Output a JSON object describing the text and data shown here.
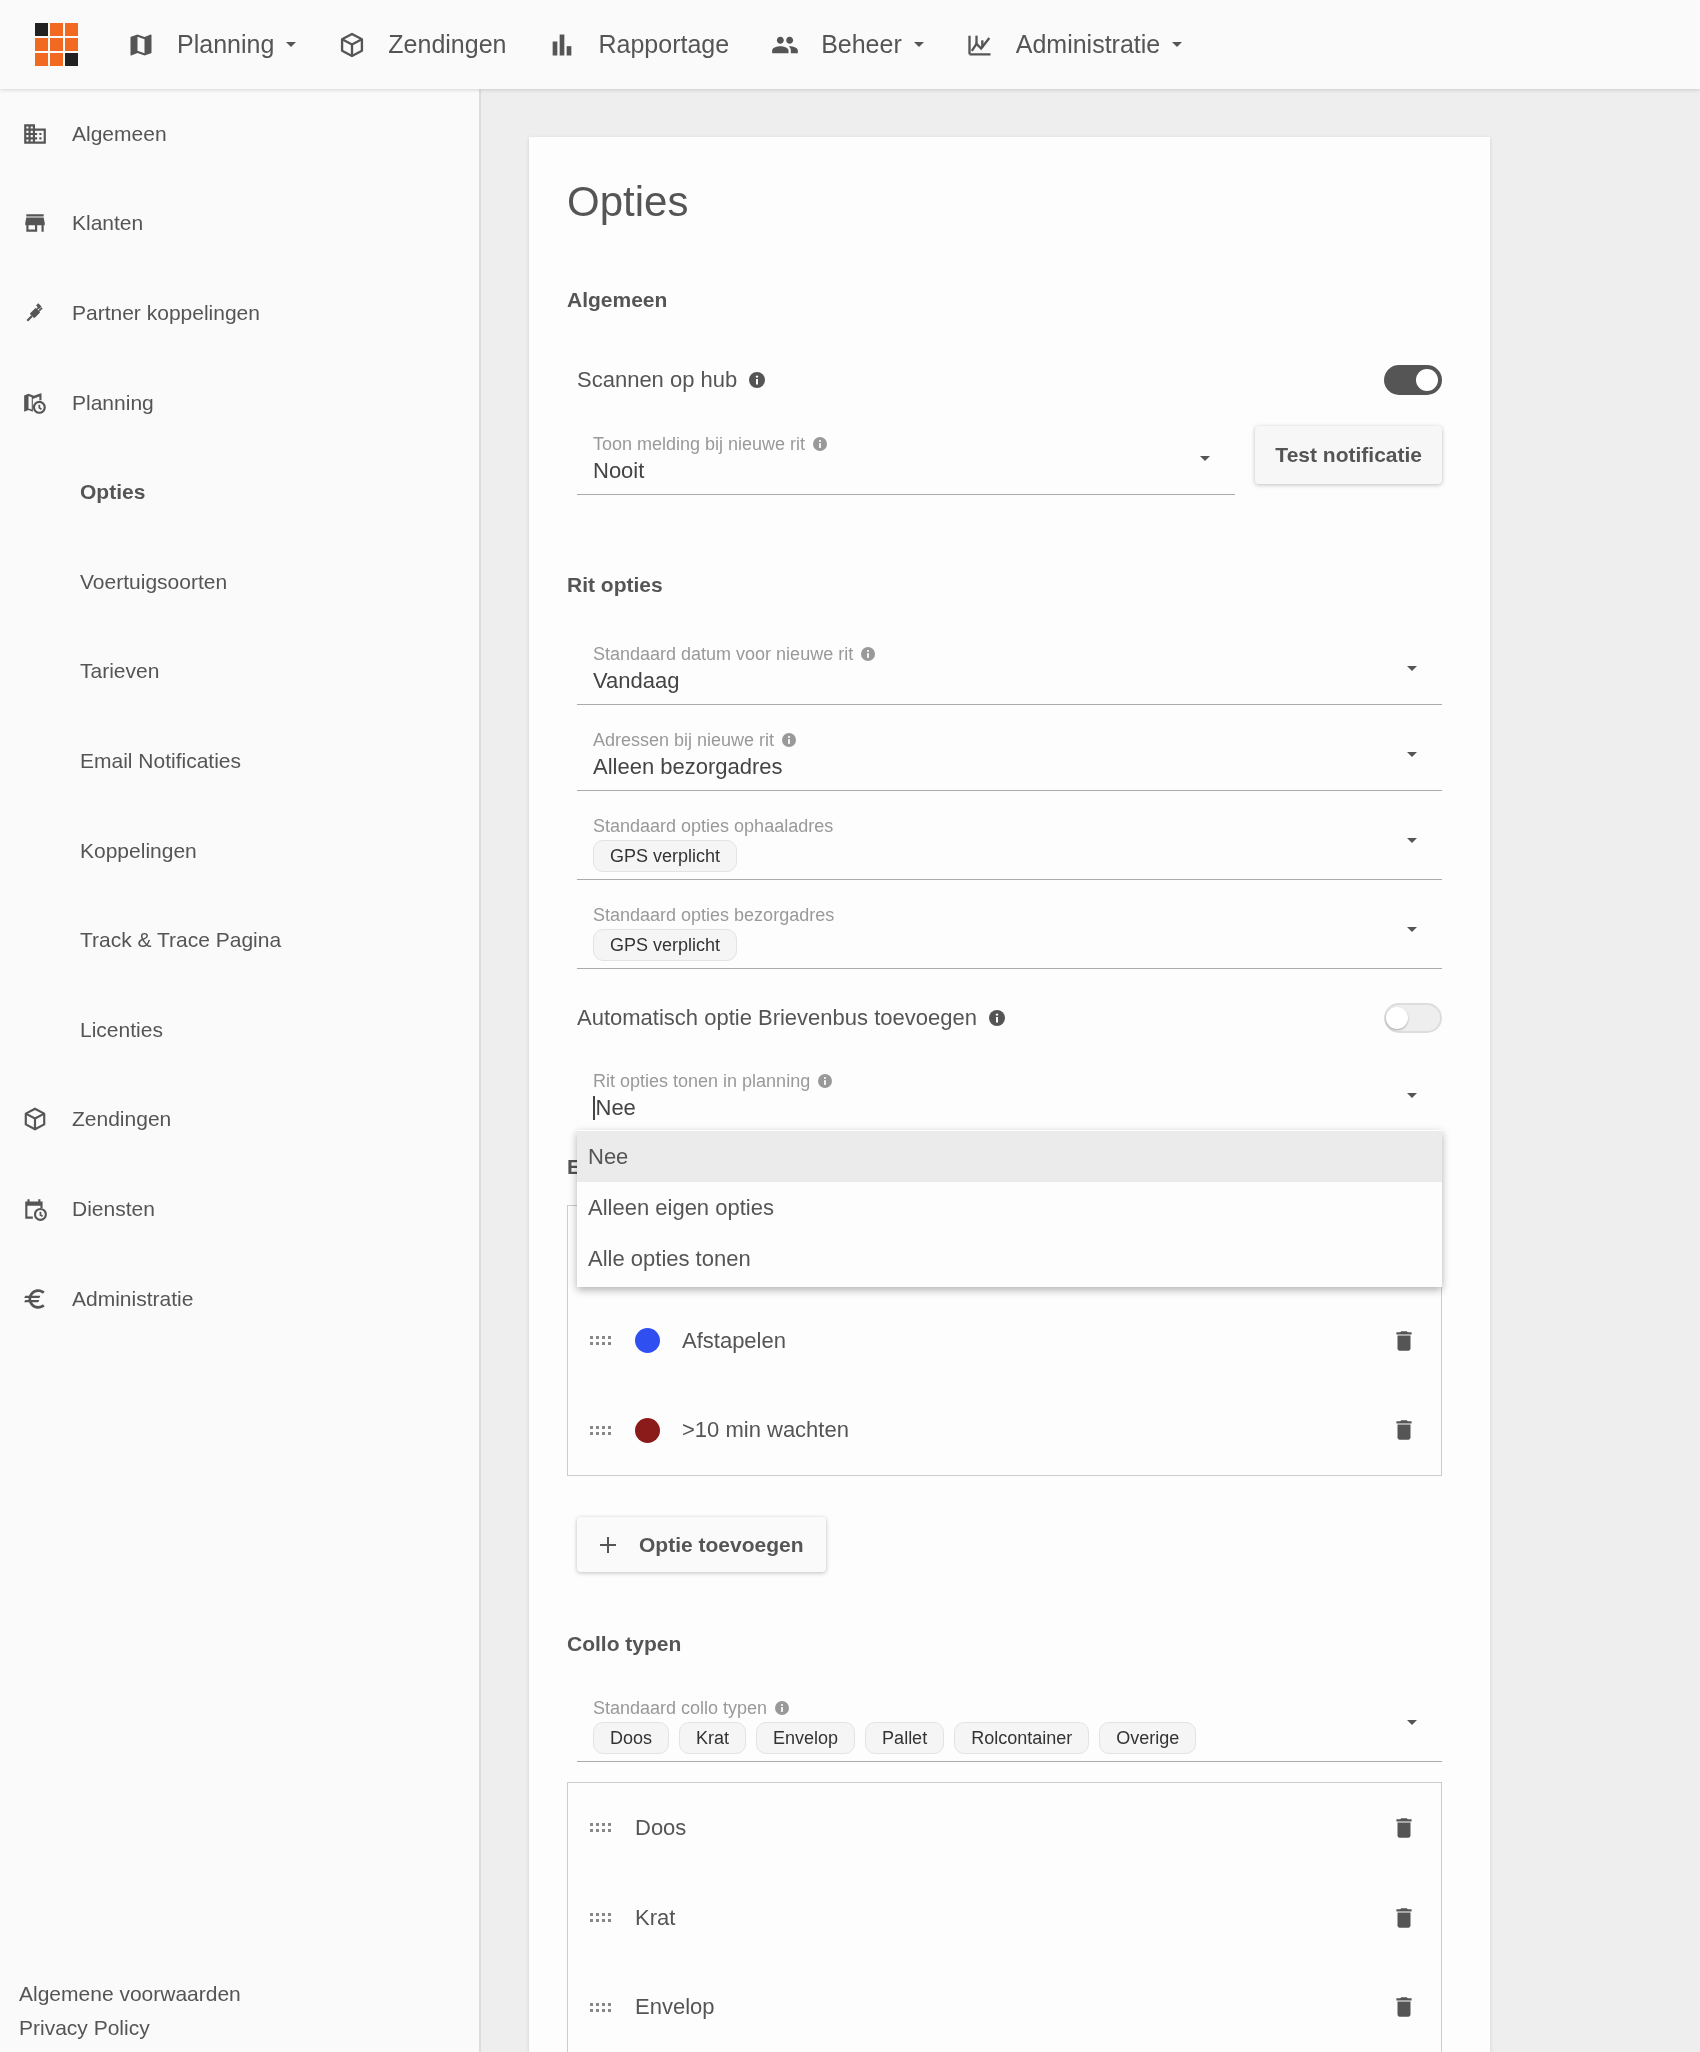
{
  "top_nav": [
    {
      "label": "Planning",
      "dropdown": true
    },
    {
      "label": "Zendingen",
      "dropdown": false
    },
    {
      "label": "Rapportage",
      "dropdown": false
    },
    {
      "label": "Beheer",
      "dropdown": true
    },
    {
      "label": "Administratie",
      "dropdown": true
    }
  ],
  "sidebar": {
    "items": [
      {
        "label": "Algemeen",
        "selected": false
      },
      {
        "label": "Klanten",
        "selected": false
      },
      {
        "label": "Partner koppelingen",
        "selected": false
      },
      {
        "label": "Planning",
        "selected": false,
        "expanded": true,
        "children": [
          {
            "label": "Opties",
            "selected": true
          },
          {
            "label": "Voertuigsoorten",
            "selected": false
          },
          {
            "label": "Tarieven",
            "selected": false
          },
          {
            "label": "Email Notificaties",
            "selected": false
          },
          {
            "label": "Koppelingen",
            "selected": false
          },
          {
            "label": "Track & Trace Pagina",
            "selected": false
          },
          {
            "label": "Licenties",
            "selected": false
          }
        ]
      },
      {
        "label": "Zendingen",
        "selected": false
      },
      {
        "label": "Diensten",
        "selected": false
      },
      {
        "label": "Administratie",
        "selected": false
      }
    ],
    "footer_links": [
      "Algemene voorwaarden",
      "Privacy Policy"
    ]
  },
  "card": {
    "title": "Opties",
    "sections": [
      {
        "heading": "Algemeen",
        "rows": [
          {
            "kind": "toggle",
            "label": "Scannen op hub",
            "info": true,
            "on": true
          },
          {
            "kind": "select",
            "label": "Toon melding bij nieuwe rit",
            "info": true,
            "value": "Nooit",
            "button": "Test notificatie"
          }
        ]
      },
      {
        "heading": "Rit opties",
        "rows": [
          {
            "kind": "select",
            "label": "Standaard datum voor nieuwe rit",
            "info": true,
            "value": "Vandaag"
          },
          {
            "kind": "select",
            "label": "Adressen bij nieuwe rit",
            "info": true,
            "value": "Alleen bezorgadres"
          },
          {
            "kind": "chips",
            "label": "Standaard opties ophaaladres",
            "info": false,
            "chips": [
              "GPS verplicht"
            ]
          },
          {
            "kind": "chips",
            "label": "Standaard opties bezorgadres",
            "info": false,
            "chips": [
              "GPS verplicht"
            ]
          },
          {
            "kind": "toggle",
            "label": "Automatisch optie Brievenbus toevoegen",
            "info": true,
            "on": false
          },
          {
            "kind": "select",
            "label": "Rit opties tonen in planning",
            "info": true,
            "value": "Nee",
            "focused": true,
            "options": [
              {
                "label": "Nee",
                "selected": true
              },
              {
                "label": "Alleen eigen opties",
                "selected": false
              },
              {
                "label": "Alle opties tonen",
                "selected": false
              }
            ]
          }
        ]
      },
      {
        "heading": "E",
        "rows": [
          {
            "kind": "list",
            "hidden_top": true,
            "items": [
              {
                "label": "Afstapelen",
                "color": "#2f4ff0"
              },
              {
                "label": ">10 min wachten",
                "color": "#8b1a1a"
              }
            ]
          },
          {
            "kind": "add_button",
            "label": "Optie toevoegen"
          }
        ]
      },
      {
        "heading": "Collo typen",
        "rows": [
          {
            "kind": "chips",
            "label": "Standaard collo typen",
            "info": true,
            "chips": [
              "Doos",
              "Krat",
              "Envelop",
              "Pallet",
              "Rolcontainer",
              "Overige"
            ]
          },
          {
            "kind": "list",
            "hidden_top": false,
            "items": [
              {
                "label": "Doos"
              },
              {
                "label": "Krat"
              },
              {
                "label": "Envelop"
              }
            ]
          }
        ]
      }
    ]
  }
}
